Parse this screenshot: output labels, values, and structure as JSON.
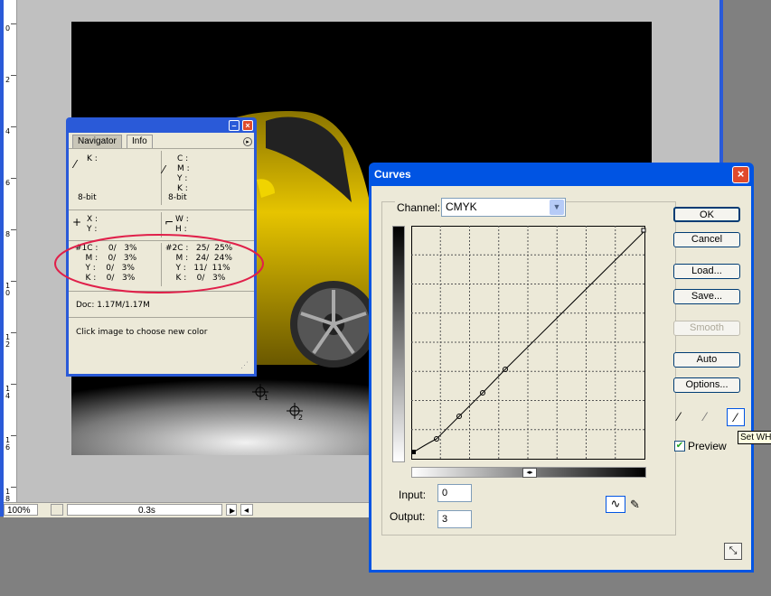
{
  "ruler": {
    "marks": [
      "0",
      "2",
      "4",
      "6",
      "8",
      "1\n0",
      "1\n2",
      "1\n4",
      "1\n6",
      "1\n8"
    ]
  },
  "status_bar": {
    "zoom": "100%",
    "timing": "0.3s"
  },
  "info_palette": {
    "tabs": [
      "Navigator",
      "Info"
    ],
    "active_tab": "Info",
    "left_top": {
      "k": "K :",
      "bitdepth": "8-bit"
    },
    "right_top": {
      "c": "C :",
      "m": "M :",
      "y": "Y :",
      "k": "K :",
      "bitdepth": "8-bit"
    },
    "xy": {
      "x": "X :",
      "y": "Y :"
    },
    "wh": {
      "w": "W :",
      "h": "H :"
    },
    "sampler1": {
      "rows": [
        "#1C :    0/   3%",
        "    M :    0/   3%",
        "    Y :    0/   3%",
        "    K :    0/   3%"
      ]
    },
    "sampler2": {
      "rows": [
        "#2C :   25/  25%",
        "    M :   24/  24%",
        "    Y :   11/  11%",
        "    K :    0/   3%"
      ]
    },
    "doc_size": "Doc: 1.17M/1.17M",
    "hint": "Click image to choose new color"
  },
  "curves": {
    "title": "Curves",
    "channel_label": "Channel:",
    "channel_value": "CMYK",
    "buttons": {
      "ok": "OK",
      "cancel": "Cancel",
      "load": "Load...",
      "save": "Save...",
      "smooth": "Smooth",
      "auto": "Auto",
      "options": "Options..."
    },
    "input_label": "Input:",
    "input_value": "0",
    "output_label": "Output:",
    "output_value": "3",
    "preview_label": "Preview",
    "preview_checked": true
  },
  "tooltip": "Set WH",
  "colors": {
    "title_blue": "#0054e3",
    "annotation_red": "#e0204a",
    "car_yellow": "#d8b400"
  }
}
